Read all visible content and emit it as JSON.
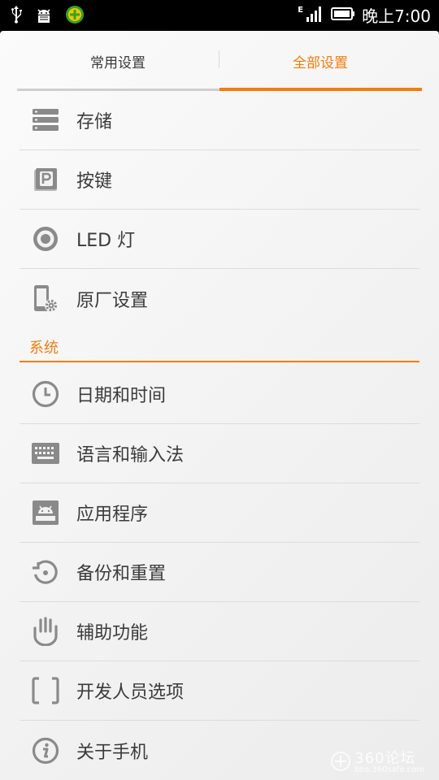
{
  "status_bar": {
    "network_type": "E",
    "time": "晚上7:00"
  },
  "tabs": [
    {
      "label": "常用设置",
      "active": false
    },
    {
      "label": "全部设置",
      "active": true
    }
  ],
  "items_top": [
    {
      "label": "存储",
      "icon": "storage-icon"
    },
    {
      "label": "按键",
      "icon": "keys-icon"
    },
    {
      "label": "LED 灯",
      "icon": "led-icon"
    },
    {
      "label": "原厂设置",
      "icon": "factory-settings-icon"
    }
  ],
  "section": {
    "title": "系统"
  },
  "items_system": [
    {
      "label": "日期和时间",
      "icon": "clock-icon"
    },
    {
      "label": "语言和输入法",
      "icon": "keyboard-icon"
    },
    {
      "label": "应用程序",
      "icon": "android-app-icon"
    },
    {
      "label": "备份和重置",
      "icon": "backup-reset-icon"
    },
    {
      "label": "辅助功能",
      "icon": "hand-icon"
    },
    {
      "label": "开发人员选项",
      "icon": "brackets-icon"
    },
    {
      "label": "关于手机",
      "icon": "info-icon"
    }
  ],
  "watermark": {
    "big": "360论坛",
    "small": "bbs.360safe.com"
  },
  "colors": {
    "accent": "#f37c10",
    "icon_grey": "#8a8a8a",
    "text": "#3b3b3b"
  }
}
